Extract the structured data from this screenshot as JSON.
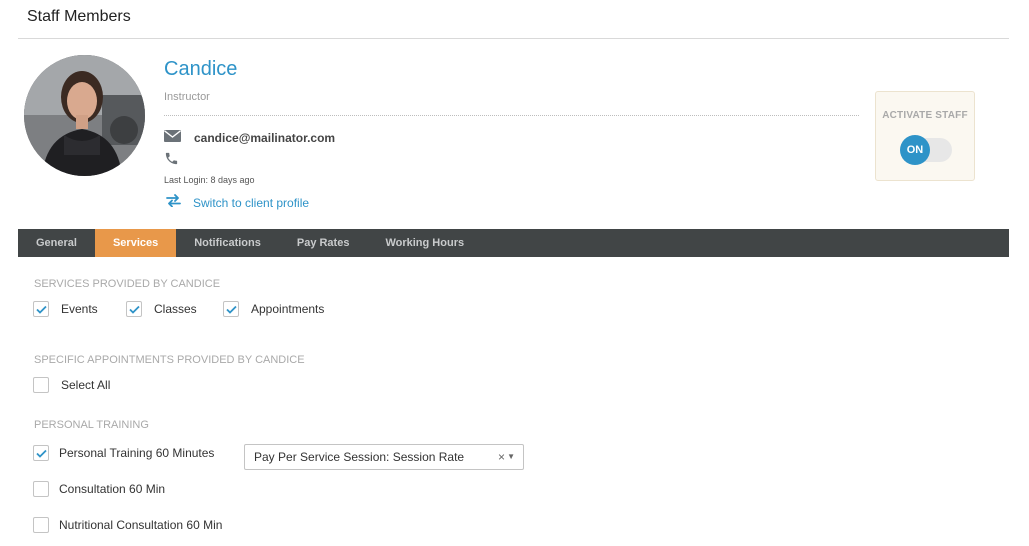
{
  "page": {
    "title": "Staff Members"
  },
  "profile": {
    "name": "Candice",
    "role": "Instructor",
    "email": "candice@mailinator.com",
    "last_login": "Last Login: 8 days ago",
    "switch_label": "Switch to client profile"
  },
  "activate": {
    "label": "ACTIVATE STAFF",
    "toggle_text": "ON",
    "state": "on"
  },
  "tabs": [
    {
      "label": "General",
      "active": false
    },
    {
      "label": "Services",
      "active": true
    },
    {
      "label": "Notifications",
      "active": false
    },
    {
      "label": "Pay Rates",
      "active": false
    },
    {
      "label": "Working Hours",
      "active": false
    }
  ],
  "services": {
    "heading": "SERVICES PROVIDED BY CANDICE",
    "items": [
      {
        "label": "Events",
        "checked": true
      },
      {
        "label": "Classes",
        "checked": true
      },
      {
        "label": "Appointments",
        "checked": true
      }
    ]
  },
  "appointments": {
    "heading": "SPECIFIC APPOINTMENTS PROVIDED BY CANDICE",
    "select_all": {
      "label": "Select All",
      "checked": false
    }
  },
  "personal_training": {
    "heading": "PERSONAL TRAINING",
    "items": [
      {
        "label": "Personal Training 60 Minutes",
        "checked": true
      },
      {
        "label": "Consultation 60 Min",
        "checked": false
      },
      {
        "label": "Nutritional Consultation 60 Min",
        "checked": false
      }
    ],
    "rate_select": {
      "value": "Pay Per Service Session: Session Rate",
      "clear": "×",
      "caret": "▼"
    }
  },
  "colors": {
    "accent": "#2e93c8",
    "tab_active": "#e8984a",
    "tab_bar": "#414546",
    "activate_bg": "#fbf8f1"
  },
  "icons": {
    "email": "envelope-icon",
    "phone": "phone-icon",
    "switch": "swap-arrows-icon",
    "check": "checkmark-icon"
  }
}
